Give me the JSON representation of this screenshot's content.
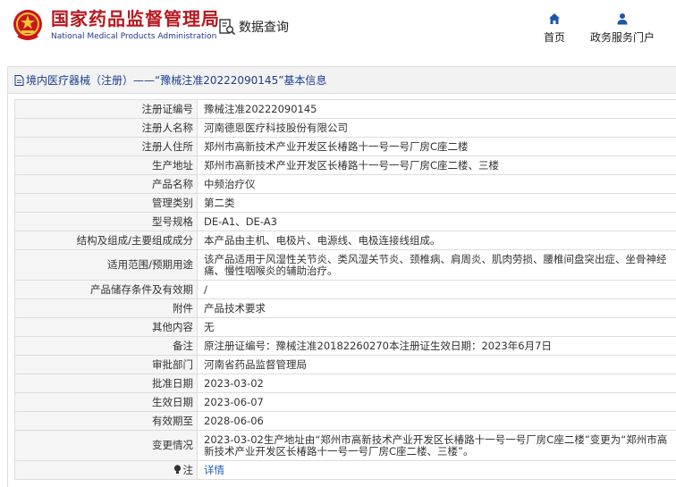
{
  "site": {
    "name_cn": "国家药品监督管理局",
    "name_en": "National Medical Products Administration",
    "section_title": "数据查询"
  },
  "nav": [
    {
      "label": "首页",
      "icon": "home-icon"
    },
    {
      "label": "政务服务门户",
      "icon": "user-icon"
    }
  ],
  "panel": {
    "title": "境内医疗器械（注册）——“豫械注准20222090145”基本信息"
  },
  "rows": [
    {
      "label": "注册证编号",
      "value": "豫械注准20222090145"
    },
    {
      "label": "注册人名称",
      "value": "河南德恩医疗科技股份有限公司"
    },
    {
      "label": "注册人住所",
      "value": "郑州市高新技术产业开发区长椿路十一号一号厂房C座二楼"
    },
    {
      "label": "生产地址",
      "value": "郑州市高新技术产业开发区长椿路十一号一号厂房C座二楼、三楼"
    },
    {
      "label": "产品名称",
      "value": "中频治疗仪"
    },
    {
      "label": "管理类别",
      "value": "第二类"
    },
    {
      "label": "型号规格",
      "value": "DE-A1、DE-A3"
    },
    {
      "label": "结构及组成/主要组成成分",
      "value": "本产品由主机、电极片、电源线、电极连接线组成。"
    },
    {
      "label": "适用范围/预期用途",
      "value": "该产品适用于风湿性关节炎、类风湿关节炎、颈椎病、肩周炎、肌肉劳损、腰椎间盘突出症、坐骨神经痛、慢性咽喉炎的辅助治疗。"
    },
    {
      "label": "产品储存条件及有效期",
      "value": "/"
    },
    {
      "label": "附件",
      "value": "产品技术要求"
    },
    {
      "label": "其他内容",
      "value": "无"
    },
    {
      "label": "备注",
      "value": "原注册证编号：豫械注准20182260270本注册证生效日期：2023年6月7日"
    },
    {
      "label": "审批部门",
      "value": "河南省药品监督管理局"
    },
    {
      "label": "批准日期",
      "value": "2023-03-02"
    },
    {
      "label": "生效日期",
      "value": "2023-06-07"
    },
    {
      "label": "有效期至",
      "value": "2028-06-06"
    },
    {
      "label": "变更情况",
      "value": "2023-03-02生产地址由“郑州市高新技术产业开发区长椿路十一号一号厂房C座二楼”变更为“郑州市高新技术产业开发区长椿路十一号一号厂房C座二楼、三楼”。"
    }
  ],
  "note_row": {
    "label": "注",
    "link": "详情",
    "icon": "note-icon"
  }
}
